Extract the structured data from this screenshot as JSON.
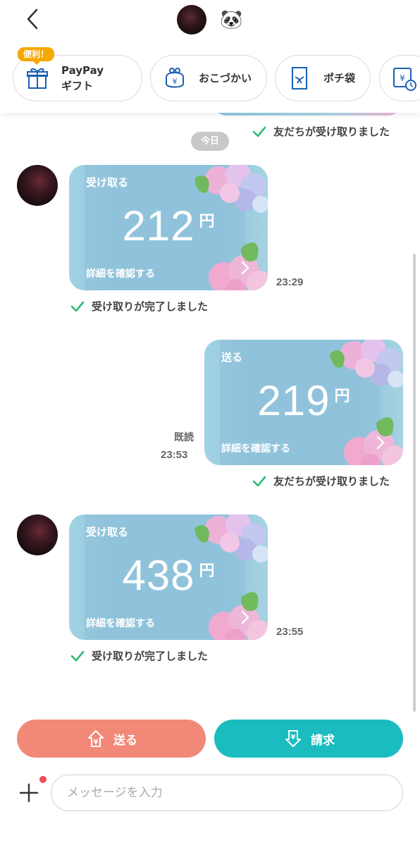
{
  "header": {
    "contact_emoji": "🐼"
  },
  "shortcuts": [
    {
      "label": "PayPay\nギフト",
      "badge": "便利！",
      "icon": "gift-icon"
    },
    {
      "label": "おこづかい",
      "icon": "purse-icon"
    },
    {
      "label": "ポチ袋",
      "icon": "envelope-icon"
    },
    {
      "label": "",
      "icon": "scheduled-payment-icon"
    }
  ],
  "chat": {
    "top_status": "友だちが受け取りました",
    "date_separator": "今日",
    "messages": [
      {
        "direction": "received",
        "title": "受け取る",
        "amount": "212",
        "unit": "円",
        "details": "詳細を確認する",
        "time": "23:29",
        "status": "受け取りが完了しました"
      },
      {
        "direction": "sent",
        "title": "送る",
        "amount": "219",
        "unit": "円",
        "details": "詳細を確認する",
        "read": "既読",
        "time": "23:53",
        "status": "友だちが受け取りました"
      },
      {
        "direction": "received",
        "title": "受け取る",
        "amount": "438",
        "unit": "円",
        "details": "詳細を確認する",
        "time": "23:55",
        "status": "受け取りが完了しました"
      }
    ]
  },
  "actions": {
    "send_label": "送る",
    "request_label": "請求"
  },
  "composer": {
    "placeholder": "メッセージを入力"
  },
  "colors": {
    "send": "#f28878",
    "request": "#1bbcbf",
    "check": "#2dbb77",
    "card": "#93c7dd"
  }
}
